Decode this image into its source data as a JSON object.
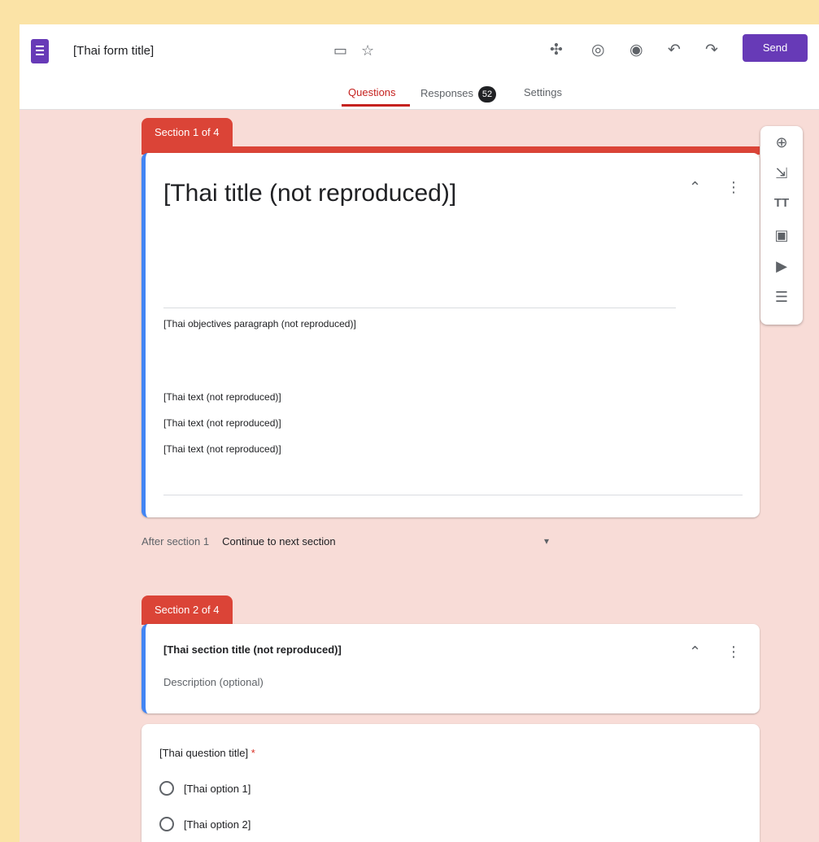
{
  "window": {
    "doc_title": "[Thai form title]"
  },
  "toolbar": {
    "send_label": "Send"
  },
  "tabs": [
    {
      "label": "Questions"
    },
    {
      "label": "Responses",
      "badge": "52"
    },
    {
      "label": "Settings"
    }
  ],
  "section1": {
    "tab_label": "Section 1 of 4",
    "title": "[Thai title (not reproduced)]",
    "desc_p1": "[Thai objectives paragraph (not reproduced)]",
    "desc_p2": "[Thai text (not reproduced)]",
    "desc_p3": "[Thai text (not reproduced)]",
    "desc_p4": "[Thai text (not reproduced)]"
  },
  "after_section": {
    "label": "After section 1",
    "value": "Continue to next section"
  },
  "section2": {
    "tab_label": "Section 2 of 4",
    "title": "[Thai section title (not reproduced)]",
    "desc_placeholder": "Description (optional)"
  },
  "question1": {
    "title": "[Thai question title]",
    "options": [
      {
        "label": "[Thai option 1]"
      },
      {
        "label": "[Thai option 2]"
      }
    ]
  },
  "colors": {
    "accent": "#673ab7",
    "section": "#db4437",
    "focus": "#4285f4"
  },
  "icons": [
    "forms-icon",
    "folder-icon",
    "star-icon",
    "addon-icon",
    "palette-icon",
    "preview-icon",
    "undo-icon",
    "redo-icon",
    "add-question-icon",
    "import-questions-icon",
    "add-title-icon",
    "add-image-icon",
    "add-video-icon",
    "add-section-icon",
    "collapse-icon",
    "more-icon",
    "dropdown-icon"
  ]
}
